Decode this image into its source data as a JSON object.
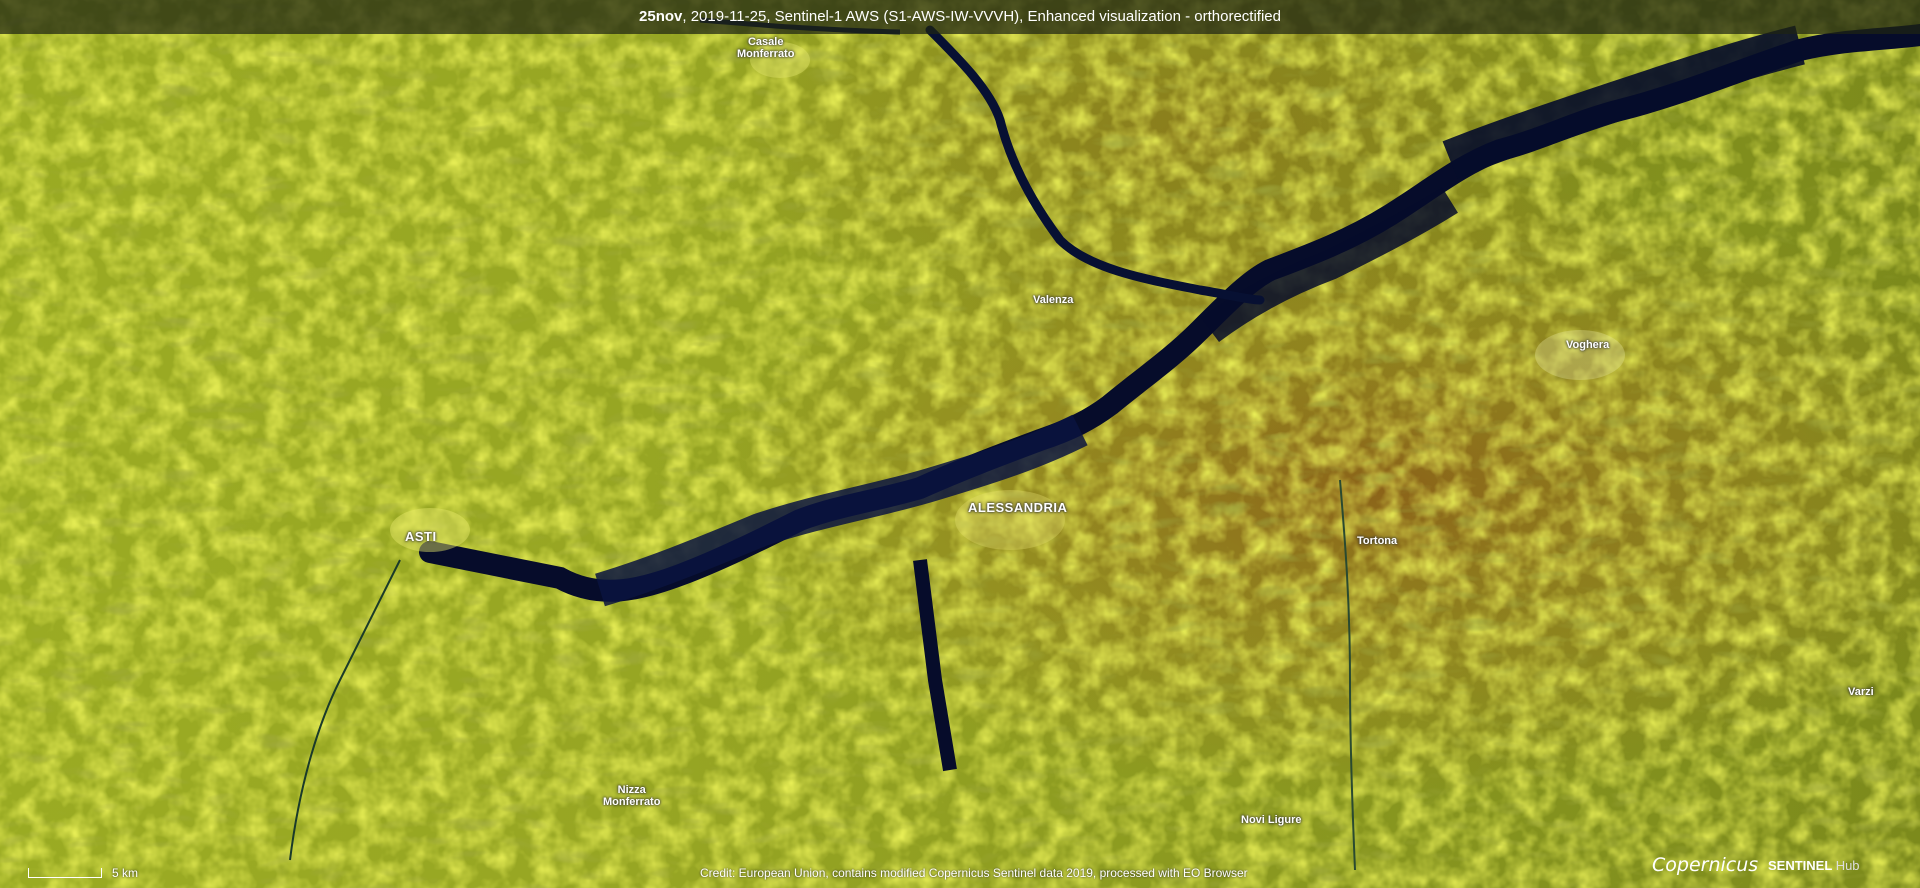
{
  "header": {
    "title_bold": "25nov",
    "title_rest": ", 2019-11-25, Sentinel-1 AWS (S1-AWS-IW-VVVH), Enhanced visualization - orthorectified"
  },
  "places": {
    "casale_line1": "Casale",
    "casale_line2": "Monferrato",
    "valenza": "Valenza",
    "voghera": "Voghera",
    "alessandria": "ALESSANDRIA",
    "asti": "ASTI",
    "tortona": "Tortona",
    "varzi": "Varzi",
    "nizza_line1": "Nizza",
    "nizza_line2": "Monferrato",
    "novi": "Novi Ligure"
  },
  "scale": {
    "label": "5 km"
  },
  "credit": "Credit: European Union, contains modified Copernicus Sentinel data 2019, processed with EO Browser",
  "logos": {
    "copernicus": "Copernicus",
    "sentinel": "SENTINEL",
    "hub": "Hub"
  },
  "colors": {
    "terrain_base": "#7c8a1c",
    "terrain_bright": "#c9d62a",
    "plain_orange": "#9a6a1e",
    "water": "#060c2a",
    "title_bg": "#1e2414"
  }
}
